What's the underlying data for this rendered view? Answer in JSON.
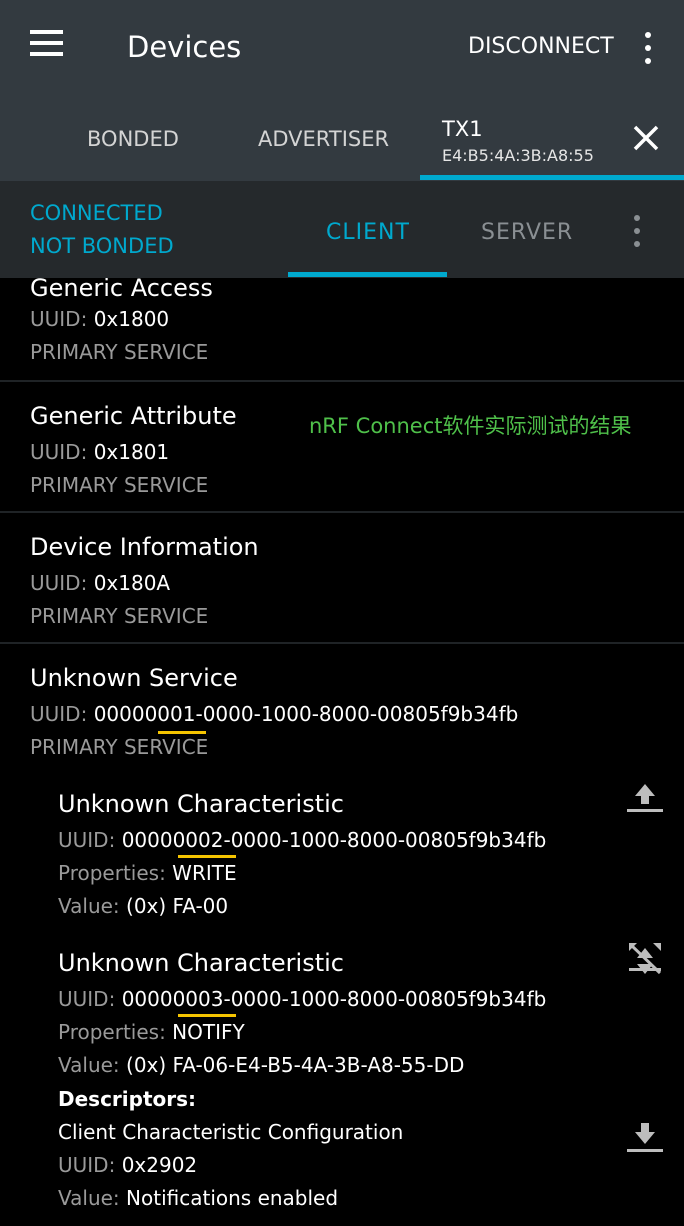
{
  "toolbar": {
    "title": "Devices",
    "disconnect_label": "DISCONNECT"
  },
  "tabs": {
    "bonded": "BONDED",
    "advertiser": "ADVERTISER",
    "device": {
      "name": "TX1",
      "address": "E4:B5:4A:3B:A8:55"
    }
  },
  "connection": {
    "state": "CONNECTED",
    "bond": "NOT BONDED"
  },
  "subtabs": {
    "client": "CLIENT",
    "server": "SERVER"
  },
  "annotation": "nRF Connect软件实际测试的结果",
  "labels": {
    "uuid": "UUID:",
    "properties": "Properties:",
    "value": "Value:",
    "descriptors": "Descriptors:"
  },
  "services": [
    {
      "name": "Generic Access",
      "uuid": "0x1800",
      "type": "PRIMARY SERVICE"
    },
    {
      "name": "Generic Attribute",
      "uuid": "0x1801",
      "type": "PRIMARY SERVICE"
    },
    {
      "name": "Device Information",
      "uuid": "0x180A",
      "type": "PRIMARY SERVICE"
    },
    {
      "name": "Unknown Service",
      "uuid": "00000001-0000-1000-8000-00805f9b34fb",
      "type": "PRIMARY SERVICE"
    }
  ],
  "characteristics": [
    {
      "name": "Unknown Characteristic",
      "uuid": "00000002-0000-1000-8000-00805f9b34fb",
      "properties": "WRITE",
      "value": "(0x) FA-00"
    },
    {
      "name": "Unknown Characteristic",
      "uuid": "00000003-0000-1000-8000-00805f9b34fb",
      "properties": "NOTIFY",
      "value": "(0x) FA-06-E4-B5-4A-3B-A8-55-DD"
    }
  ],
  "descriptor": {
    "name": "Client Characteristic Configuration",
    "uuid": "0x2902",
    "value": "Notifications enabled"
  },
  "colors": {
    "accent": "#00a9ce",
    "toolbar": "#333a40",
    "annotation": "#4fc04a",
    "underline": "#f5c400"
  }
}
